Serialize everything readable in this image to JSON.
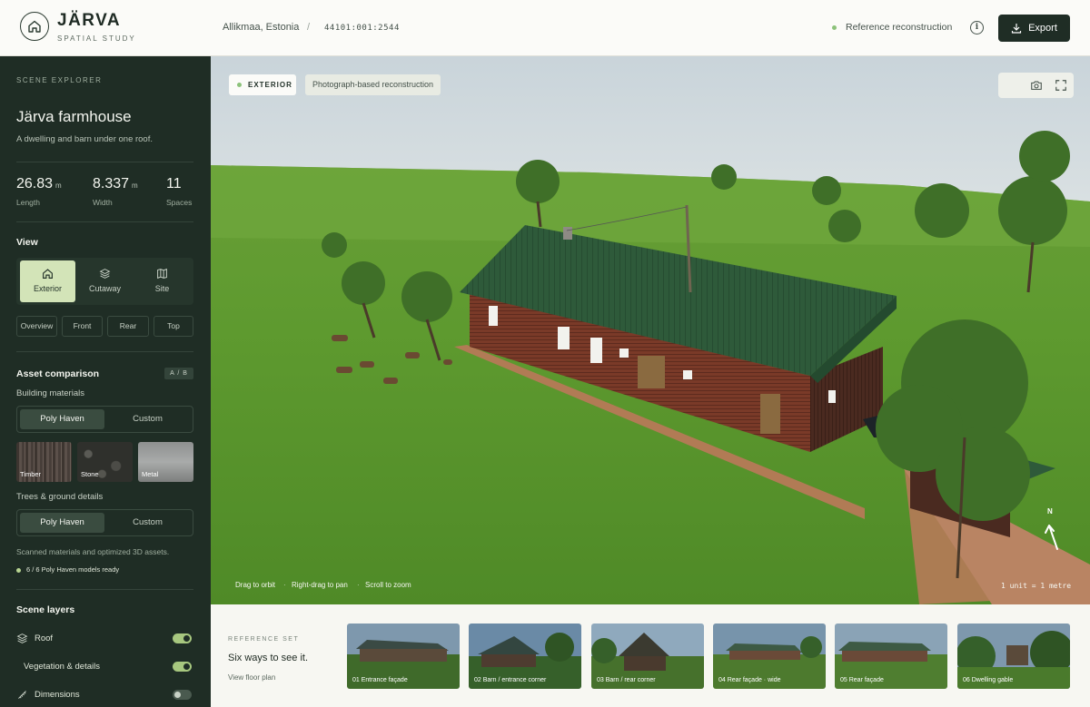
{
  "header": {
    "brand": "JÄRVA",
    "brand_sub": "SPATIAL STUDY",
    "location": "Allikmaa, Estonia",
    "separator": "/",
    "parcel_id": "44101:001:2544",
    "status": "Reference reconstruction",
    "export_label": "Export",
    "icons": {
      "logo": "house-icon",
      "info": "info-icon",
      "export": "download-icon"
    },
    "status_color": "#8cc27a"
  },
  "sidebar": {
    "kicker": "SCENE EXPLORER",
    "title": "Järva farmhouse",
    "subtitle": "A dwelling and barn under one roof.",
    "stats": [
      {
        "value": "26.83",
        "unit": "m",
        "label": "Length"
      },
      {
        "value": "8.337",
        "unit": "m",
        "label": "Width"
      },
      {
        "value": "11",
        "unit": "",
        "label": "Spaces"
      }
    ],
    "view_title": "View",
    "view_modes": [
      {
        "label": "Exterior",
        "icon": "house-icon",
        "active": true
      },
      {
        "label": "Cutaway",
        "icon": "layers-icon",
        "active": false
      },
      {
        "label": "Site",
        "icon": "map-icon",
        "active": false
      }
    ],
    "camera_views": [
      "Overview",
      "Front",
      "Rear",
      "Top"
    ],
    "asset_title": "Asset comparison",
    "asset_badge": "A / B",
    "materials_label": "Building materials",
    "materials_options": [
      "Poly Haven",
      "Custom"
    ],
    "materials_swatches": [
      "Timber",
      "Stone",
      "Metal"
    ],
    "trees_label": "Trees & ground details",
    "trees_options": [
      "Poly Haven",
      "Custom"
    ],
    "asset_note": "Scanned materials and optimized 3D assets.",
    "ready_status": "6 / 6 Poly Haven models ready",
    "layers_title": "Scene layers",
    "layers": [
      {
        "label": "Roof",
        "icon": "layers-icon",
        "on": true
      },
      {
        "label": "Vegetation & details",
        "icon": "",
        "on": true
      },
      {
        "label": "Dimensions",
        "icon": "ruler-icon",
        "on": false
      }
    ],
    "accent": "#d3e4b8"
  },
  "viewport": {
    "mode_chip": "EXTERIOR",
    "desc_chip": "Photograph-based reconstruction",
    "tools": [
      "camera-icon",
      "fullscreen-icon"
    ],
    "hints": [
      "Drag to orbit",
      "Right-drag to pan",
      "Scroll to zoom"
    ],
    "hint_separator": "·",
    "scale": "1 unit = 1 metre",
    "north": "N"
  },
  "reference": {
    "kicker": "REFERENCE SET",
    "title": "Six ways to see it.",
    "link": "View floor plan",
    "thumbs": [
      {
        "label": "01  Entrance façade"
      },
      {
        "label": "02  Barn / entrance corner"
      },
      {
        "label": "03  Barn / rear corner"
      },
      {
        "label": "04  Rear façade · wide"
      },
      {
        "label": "05  Rear façade"
      },
      {
        "label": "06  Dwelling gable"
      }
    ]
  }
}
